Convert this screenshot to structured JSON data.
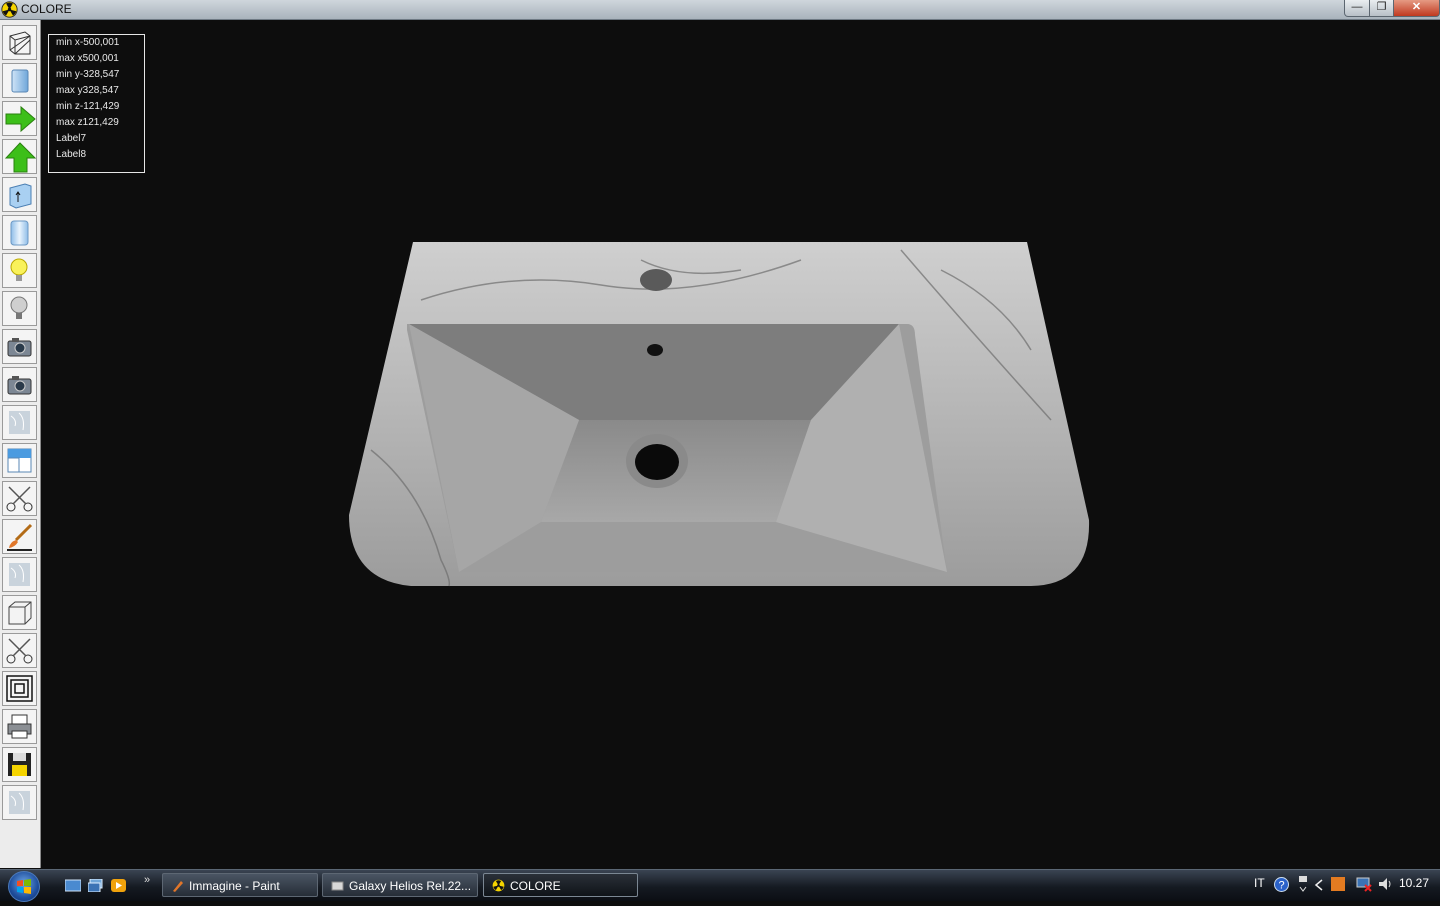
{
  "window": {
    "title": "COLORE",
    "min_icon": "minimize-icon",
    "max_icon": "restore-icon",
    "close_icon": "close-icon",
    "min_glyph": "—",
    "max_glyph": "❐",
    "close_glyph": "✕"
  },
  "info": {
    "lines": [
      "min x-500,001",
      "max x500,001",
      "min y-328,547",
      "max y328,547",
      "min z-121,429",
      "max z121,429",
      "Label7",
      "Label8"
    ]
  },
  "toolbar": {
    "tools": [
      "wireframe-box-icon",
      "solid-box-icon",
      "arrow-right-icon",
      "arrow-up-icon",
      "cube-up-icon",
      "cylinder-icon",
      "light-on-icon",
      "light-off-icon",
      "camera-icon",
      "camera-alt-icon",
      "texture-icon",
      "window-split-icon",
      "scissors-icon",
      "brush-icon",
      "texture-alt-icon",
      "cube-icon",
      "scissors-alt-icon",
      "concentric-squares-icon",
      "printer-icon",
      "floppy-disk-icon",
      "texture-extra-icon"
    ]
  },
  "taskbar": {
    "items": [
      {
        "label": "Immagine - Paint",
        "active": false
      },
      {
        "label": "Galaxy Helios  Rel.22...",
        "active": false
      },
      {
        "label": "COLORE",
        "active": true
      }
    ],
    "quicklaunch_chevron": "»",
    "lang": "IT",
    "clock": "10.27"
  },
  "colors": {
    "accent_yellow": "#f5d400",
    "arrow_green": "#3cbf19",
    "marble": "#c8c8c8"
  }
}
